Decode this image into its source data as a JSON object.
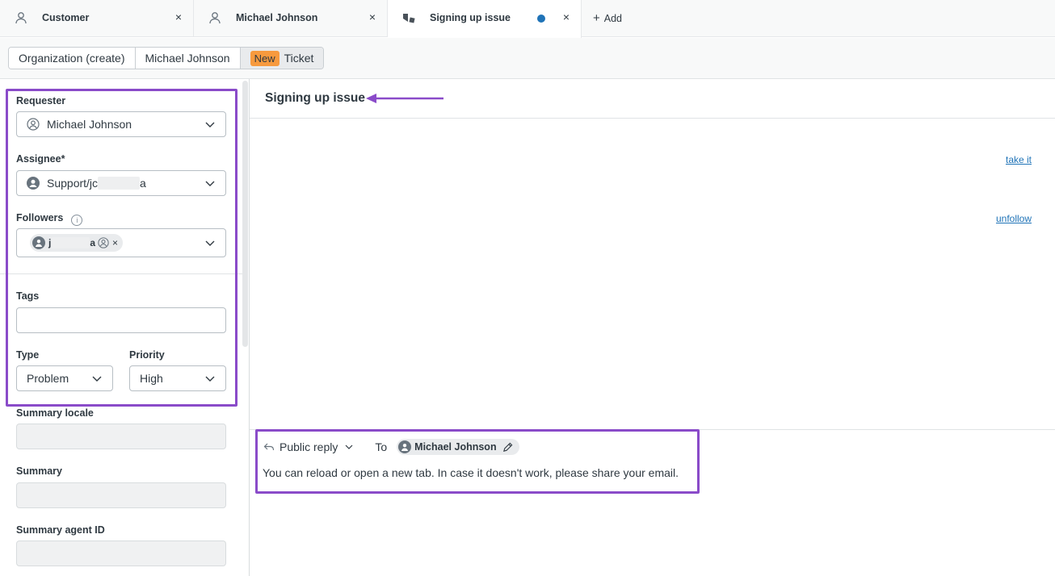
{
  "tabs": [
    {
      "label": "Customer",
      "icon": "person-icon",
      "close": "×"
    },
    {
      "label": "Michael Johnson",
      "icon": "person-icon",
      "close": "×"
    },
    {
      "label": "Signing up issue",
      "icon": "ticket-icon",
      "close": "×",
      "unsaved": true
    }
  ],
  "add_tab": {
    "icon": "+",
    "label": "Add"
  },
  "breadcrumb": {
    "items": [
      "Organization (create)",
      "Michael Johnson"
    ],
    "badge": "New",
    "last": "Ticket"
  },
  "form": {
    "requester": {
      "label": "Requester",
      "value": "Michael Johnson"
    },
    "assignee": {
      "label": "Assignee*",
      "link": "take it",
      "value_prefix": "Support/jc",
      "value_hidden": "xxxxxxxx",
      "value_suffix": "a"
    },
    "followers": {
      "label": "Followers",
      "info": "i",
      "link": "unfollow",
      "chip_prefix": "j",
      "chip_hidden": "xxxxxxxx",
      "chip_suffix": "a",
      "chip_remove": "×"
    },
    "tags": {
      "label": "Tags",
      "value": ""
    },
    "type": {
      "label": "Type",
      "value": "Problem"
    },
    "priority": {
      "label": "Priority",
      "value": "High"
    },
    "summary_locale": {
      "label": "Summary locale",
      "value": ""
    },
    "summary": {
      "label": "Summary",
      "value": ""
    },
    "summary_agent_id": {
      "label": "Summary agent ID",
      "value": ""
    }
  },
  "ticket": {
    "subject": "Signing up issue"
  },
  "reply": {
    "mode": "Public reply",
    "to_label": "To",
    "to_name": "Michael Johnson",
    "body": "You can reload or open a new tab. In case it doesn't work, please share your email."
  },
  "colors": {
    "highlight": "#8a4bc9",
    "badge_new": "#f79a3e",
    "unsaved_dot": "#1f73b7",
    "link": "#1f73b7"
  }
}
